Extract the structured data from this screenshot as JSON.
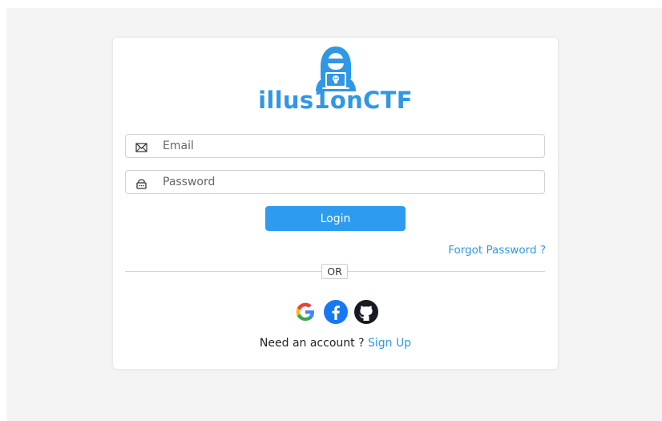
{
  "brand": {
    "name": "illus1onCTF",
    "logo_icon": "hooded-hacker-icon",
    "color": "#2f97e6"
  },
  "form": {
    "email_placeholder": "Email",
    "email_icon": "envelope-icon",
    "password_placeholder": "Password",
    "password_icon": "lock-icon",
    "login_label": "Login",
    "forgot_label": "Forgot Password ?",
    "divider_label": "OR"
  },
  "social": {
    "google_icon": "google-icon",
    "facebook_icon": "facebook-icon",
    "github_icon": "github-icon"
  },
  "signup": {
    "prompt": "Need an account ?",
    "link_label": "Sign Up"
  },
  "colors": {
    "accent": "#2f97e6",
    "button": "#2d9bef",
    "background": "#f4f4f4"
  }
}
